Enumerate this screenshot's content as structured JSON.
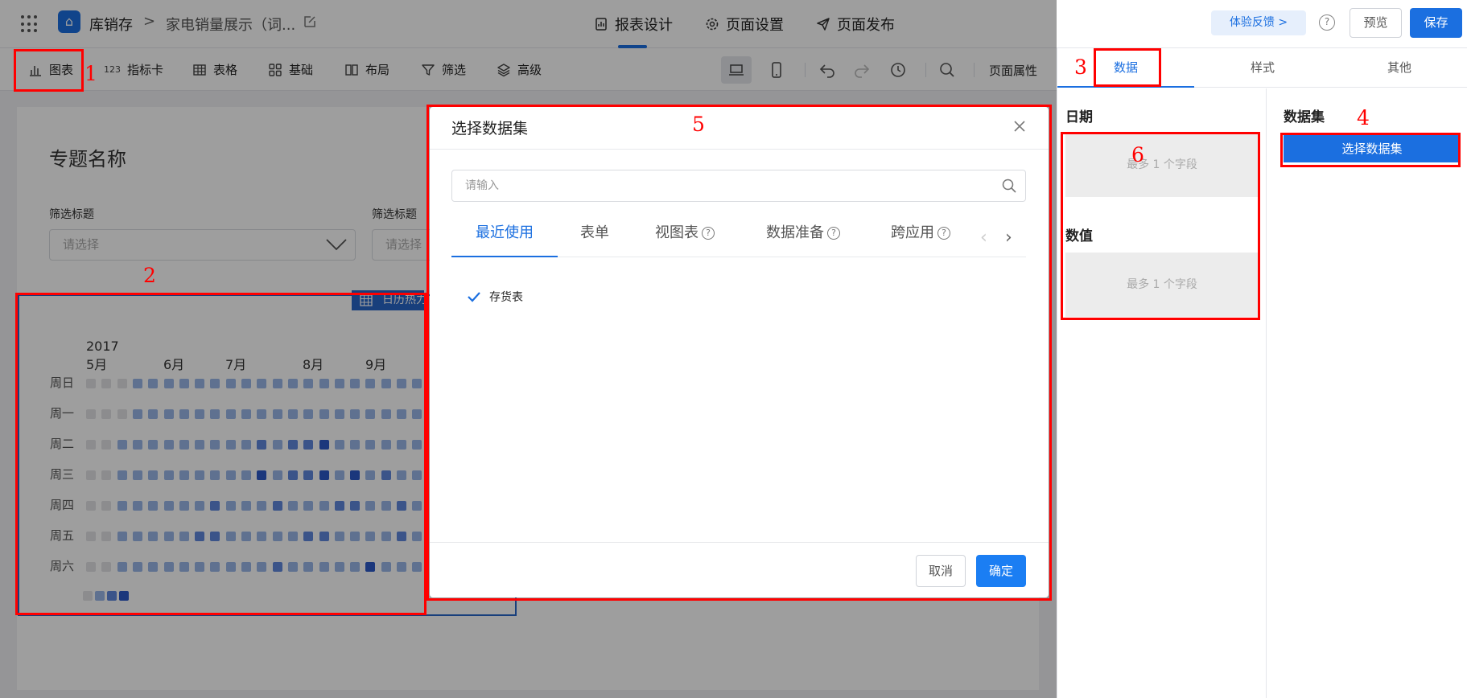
{
  "topbar": {
    "app_name": "库销存",
    "crumb_sep": ">",
    "page_name": "家电销量展示（词...",
    "tabs": [
      {
        "label": "报表设计",
        "icon": "report-icon"
      },
      {
        "label": "页面设置",
        "icon": "gear-icon"
      },
      {
        "label": "页面发布",
        "icon": "send-icon"
      }
    ],
    "feedback": "体验反馈 >",
    "help": "?",
    "preview": "预览",
    "save": "保存"
  },
  "toolbar": {
    "items": [
      {
        "label": "图表",
        "icon": "bar-chart-icon"
      },
      {
        "label": "指标卡",
        "icon": "number-icon",
        "glyph": "123"
      },
      {
        "label": "表格",
        "icon": "table-icon"
      },
      {
        "label": "基础",
        "icon": "grid-icon"
      },
      {
        "label": "布局",
        "icon": "layout-icon"
      },
      {
        "label": "筛选",
        "icon": "filter-icon"
      },
      {
        "label": "高级",
        "icon": "layers-icon"
      }
    ],
    "page_attr": "页面属性"
  },
  "canvas": {
    "topic_title": "专题名称",
    "filters": [
      {
        "label": "筛选标题",
        "placeholder": "请选择"
      },
      {
        "label": "筛选标题",
        "placeholder": "请选择"
      }
    ],
    "heatmap_tag": "日历热力",
    "year": "2017",
    "months": [
      "5月",
      "6月",
      "7月",
      "8月",
      "9月"
    ],
    "days": [
      "周日",
      "周一",
      "周二",
      "周三",
      "周四",
      "周五",
      "周六"
    ]
  },
  "chart_data": {
    "type": "heatmap",
    "title": "",
    "year": "2017",
    "x_labels": [
      "5月",
      "6月",
      "7月",
      "8月",
      "9月"
    ],
    "y_labels": [
      "周日",
      "周一",
      "周二",
      "周三",
      "周四",
      "周五",
      "周六"
    ],
    "levels": 4,
    "colors": [
      "#e3e3e6",
      "#9ab7e8",
      "#5f88dd",
      "#2c59c8"
    ],
    "grid": [
      [
        0,
        0,
        0,
        1,
        1,
        1,
        1,
        1,
        1,
        1,
        1,
        1,
        1,
        1,
        1,
        1,
        1,
        1,
        1,
        1,
        1,
        1
      ],
      [
        0,
        0,
        0,
        1,
        1,
        1,
        1,
        1,
        1,
        1,
        1,
        1,
        1,
        1,
        1,
        1,
        1,
        1,
        1,
        1,
        1,
        1
      ],
      [
        0,
        0,
        1,
        1,
        1,
        1,
        1,
        1,
        1,
        1,
        1,
        2,
        1,
        2,
        2,
        3,
        1,
        1,
        1,
        1,
        1,
        1
      ],
      [
        0,
        0,
        1,
        1,
        1,
        1,
        1,
        1,
        1,
        1,
        1,
        3,
        1,
        2,
        2,
        3,
        1,
        3,
        1,
        2,
        1,
        1
      ],
      [
        0,
        0,
        1,
        1,
        1,
        1,
        1,
        1,
        2,
        1,
        1,
        1,
        2,
        1,
        1,
        1,
        2,
        2,
        1,
        1,
        2,
        1
      ],
      [
        0,
        0,
        1,
        1,
        1,
        1,
        1,
        2,
        2,
        1,
        1,
        1,
        1,
        1,
        2,
        2,
        1,
        1,
        1,
        1,
        2,
        1
      ],
      [
        0,
        0,
        1,
        1,
        1,
        1,
        1,
        1,
        1,
        1,
        1,
        1,
        2,
        1,
        1,
        1,
        1,
        1,
        3,
        1,
        1,
        1
      ]
    ]
  },
  "right_panel": {
    "tabs": [
      "数据",
      "样式",
      "其他"
    ],
    "date_heading": "日期",
    "value_heading": "数值",
    "drop_hint": "最多 1 个字段",
    "dataset_heading": "数据集",
    "select_dataset": "选择数据集"
  },
  "dialog": {
    "title": "选择数据集",
    "search_placeholder": "请输入",
    "tabs": [
      "最近使用",
      "表单",
      "视图表",
      "数据准备",
      "跨应用"
    ],
    "items": [
      "存货表"
    ],
    "cancel": "取消",
    "ok": "确定"
  },
  "annotations": [
    "1",
    "2",
    "3",
    "4",
    "5",
    "6"
  ],
  "colors": {
    "accent": "#1b6fe0",
    "annotation": "#ff0000",
    "heat_levels": [
      "#e3e3e6",
      "#9ab7e8",
      "#5f88dd",
      "#2c59c8"
    ]
  }
}
